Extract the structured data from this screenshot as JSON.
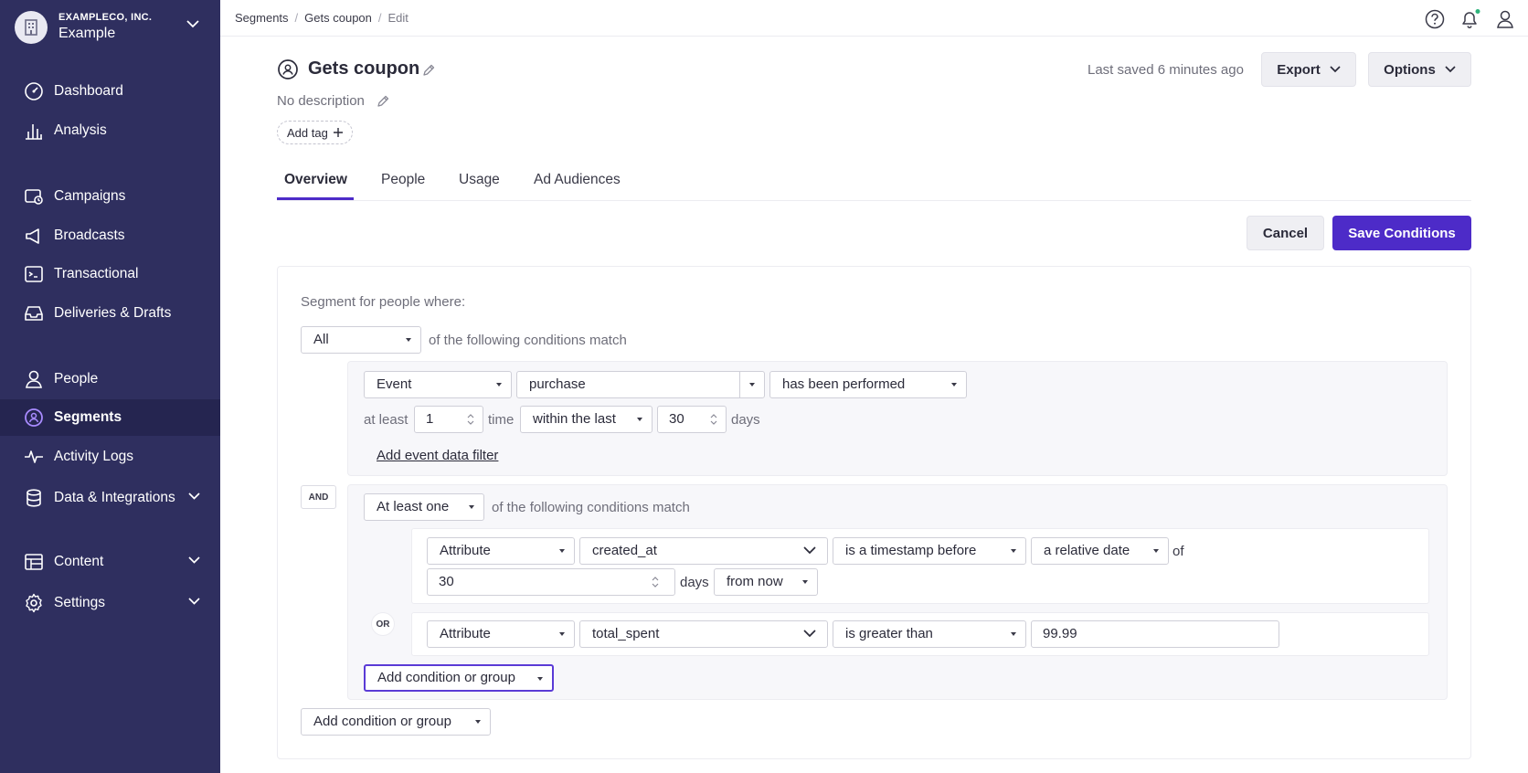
{
  "org": {
    "company": "EXAMPLECO, INC.",
    "name": "Example"
  },
  "sidebar": {
    "items": [
      {
        "label": "Dashboard"
      },
      {
        "label": "Analysis"
      },
      {
        "label": "Campaigns"
      },
      {
        "label": "Broadcasts"
      },
      {
        "label": "Transactional"
      },
      {
        "label": "Deliveries & Drafts"
      },
      {
        "label": "People"
      },
      {
        "label": "Segments"
      },
      {
        "label": "Activity Logs"
      },
      {
        "label": "Data & Integrations"
      },
      {
        "label": "Content"
      },
      {
        "label": "Settings"
      }
    ]
  },
  "breadcrumb": {
    "items": [
      "Segments",
      "Gets coupon",
      "Edit"
    ]
  },
  "header": {
    "title": "Gets coupon",
    "description": "No description",
    "add_tag": "Add tag",
    "last_saved": "Last saved 6 minutes ago",
    "export": "Export",
    "options": "Options"
  },
  "tabs": [
    {
      "label": "Overview"
    },
    {
      "label": "People"
    },
    {
      "label": "Usage"
    },
    {
      "label": "Ad Audiences"
    }
  ],
  "actions": {
    "cancel": "Cancel",
    "save": "Save Conditions"
  },
  "segment": {
    "heading": "Segment for people where:",
    "match_mode": "All",
    "match_text": "of the following conditions match",
    "condition1": {
      "type": "Event",
      "event_name": "purchase",
      "operator": "has been performed",
      "at_least_label": "at least",
      "count": "1",
      "time_label": "time",
      "window": "within the last",
      "days_value": "30",
      "days_label": "days",
      "filter_link": "Add event data filter"
    },
    "and_label": "AND",
    "group": {
      "mode": "At least one",
      "match_text": "of the following conditions match",
      "cond_a": {
        "type": "Attribute",
        "attribute": "created_at",
        "operator": "is a timestamp before",
        "date_kind": "a relative date",
        "of_label": "of",
        "value": "30",
        "days_label": "days",
        "direction": "from now"
      },
      "or_label": "OR",
      "cond_b": {
        "type": "Attribute",
        "attribute": "total_spent",
        "operator": "is greater than",
        "value": "99.99"
      },
      "add_inner": "Add condition or group"
    },
    "add_outer": "Add condition or group"
  },
  "colors": {
    "sidebar": "#2f2f5f",
    "sidebar_active": "#252550",
    "accent": "#4d2bc8"
  }
}
